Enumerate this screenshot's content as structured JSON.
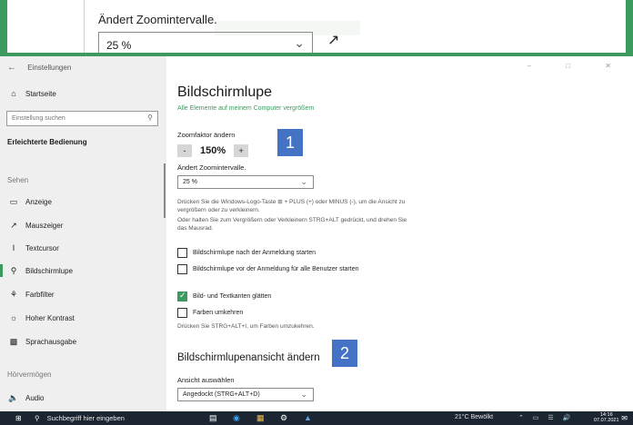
{
  "zoom_preview": {
    "label": "Ändert Zoomintervalle.",
    "value": "25 %"
  },
  "sidebar": {
    "window_title": "Einstellungen",
    "home": "Startseite",
    "search_placeholder": "Einstellung suchen",
    "category": "Erleichterte Bedienung",
    "section_sehen": "Sehen",
    "items": [
      {
        "label": "Anzeige",
        "icon": "monitor-icon"
      },
      {
        "label": "Mauszeiger",
        "icon": "mouse-pointer-icon"
      },
      {
        "label": "Textcursor",
        "icon": "text-cursor-icon"
      },
      {
        "label": "Bildschirmlupe",
        "icon": "magnifier-icon"
      },
      {
        "label": "Farbfilter",
        "icon": "color-filter-icon"
      },
      {
        "label": "Hoher Kontrast",
        "icon": "contrast-icon"
      },
      {
        "label": "Sprachausgabe",
        "icon": "narrator-icon"
      }
    ],
    "section_hoeren": "Hörvermögen",
    "audio": "Audio",
    "active_index": 3,
    "accent": "#3c9a5f"
  },
  "main": {
    "title": "Bildschirmlupe",
    "subtitle_link": "Alle Elemente auf meinem Computer vergrößern",
    "zoom_factor_label": "Zoomfaktor ändern",
    "zoom_minus": "-",
    "zoom_value": "150%",
    "zoom_plus": "+",
    "interval_label": "Ändert Zoomintervalle.",
    "interval_value": "25 %",
    "desc1": "Drücken Sie die Windows-Logo-Taste ⊞ + PLUS (+) oder MINUS (-), um die Ansicht zu vergrößern oder zu verkleinern.",
    "desc2": "Oder halten Sie zum Vergrößern oder Verkleinern STRG+ALT gedrückt, und drehen Sie das Mausrad.",
    "cb1": "Bildschirmlupe nach der Anmeldung starten",
    "cb2": "Bildschirmlupe vor der Anmeldung für alle Benutzer starten",
    "cb3": "Bild- und Textkanten glätten",
    "cb4": "Farben umkehren",
    "invert_hint": "Drücken Sie STRG+ALT+I, um Farben umzukehren.",
    "section2_title": "Bildschirmlupenansicht ändern",
    "view_label": "Ansicht auswählen",
    "view_value": "Angedockt (STRG+ALT+D)",
    "badge1": "1",
    "badge2": "2",
    "badge_color": "#4472c4"
  },
  "taskbar": {
    "search_placeholder": "Suchbegriff hier eingeben",
    "weather": "21°C  Bewölkt",
    "time": "14:16",
    "date": "07.07.2021"
  }
}
